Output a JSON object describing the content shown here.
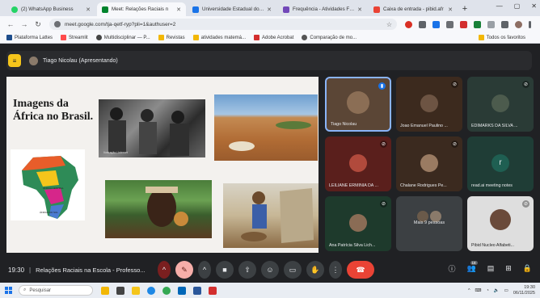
{
  "browser": {
    "tabs": [
      {
        "label": "(2) WhatsApp Business",
        "color": "#25d366",
        "active": false
      },
      {
        "label": "Meet: Relações Raciais n",
        "color": "#00832d",
        "active": true
      },
      {
        "label": "Universidade Estadual do Ce",
        "color": "#1a73e8",
        "active": false
      },
      {
        "label": "Frequência - Atividades Form",
        "color": "#7248b9",
        "active": false
      },
      {
        "label": "Caixa de entrada - pibid.afr",
        "color": "#ea4335",
        "active": false
      }
    ],
    "url": "meet.google.com/tja-qetf-ryp?pli=1&authuser=2",
    "bookmarks": [
      {
        "label": "Plataforma Lattes",
        "color": "#1d4d8c"
      },
      {
        "label": "Streamlit",
        "color": "#ff4b4b"
      },
      {
        "label": "Multidisciplinar — P...",
        "color": "#444444"
      },
      {
        "label": "Revistas",
        "color": "#f2b705"
      },
      {
        "label": "atividades matemá...",
        "color": "#f2b705"
      },
      {
        "label": "Adobe Acrobat",
        "color": "#d32f2f"
      },
      {
        "label": "Comparação de mo...",
        "color": "#555555"
      }
    ],
    "all_bookmarks": "Todos os favoritos"
  },
  "meet": {
    "presenter": "Tiago Nicolau (Apresentando)",
    "slide": {
      "title": "Imagens da África no Brasil.",
      "caption": "Ilustração / Internet",
      "map_labels": [
        "ÁFRICA CENTRAL",
        "ÁFRICA DO SUL"
      ]
    },
    "participants": [
      {
        "name": "Tiago Nicolau",
        "bg": "#5b4636",
        "avatar": "#8b6e55",
        "speaking": true
      },
      {
        "name": "Joao Emanuel Paulino ...",
        "bg": "#3c2a1e",
        "avatar": "#6d5443",
        "muted": true
      },
      {
        "name": "EDIMARKS DA SILVA ...",
        "bg": "#2a3b36",
        "avatar": "#4c5b4d",
        "muted": true
      },
      {
        "name": "LEILIANE ERMINIA DA ...",
        "bg": "#5a1f1c",
        "avatar": "#b14a3c",
        "muted": true
      },
      {
        "name": "Chalane Rodrigues Pe...",
        "bg": "#3b2a1f",
        "avatar": "#9a7b62",
        "muted": true
      },
      {
        "name": "read.ai meeting notes",
        "bg": "#1f3d36",
        "avatar": "#1f5f52",
        "letter": "r"
      },
      {
        "name": "Ana Patrícia Silva Lich...",
        "bg": "#1e3a2c",
        "avatar": "#8a6c55",
        "muted": true
      },
      {
        "name": "Mais 9 pessoas",
        "bg": "#3c4043",
        "avatar": "#5f6368"
      },
      {
        "name": "Pibid Nucleo Alfabeti...",
        "bg": "#dedede",
        "avatar": "#6a4a3a",
        "muted": true
      }
    ],
    "bottom": {
      "clock": "19:30",
      "meeting_name": "Relações Raciais na Escola - Professo...",
      "participant_count": "18"
    }
  },
  "taskbar": {
    "search_placeholder": "Pesquisar",
    "time": "19:30",
    "date": "06/11/2025"
  },
  "chart_data": null
}
